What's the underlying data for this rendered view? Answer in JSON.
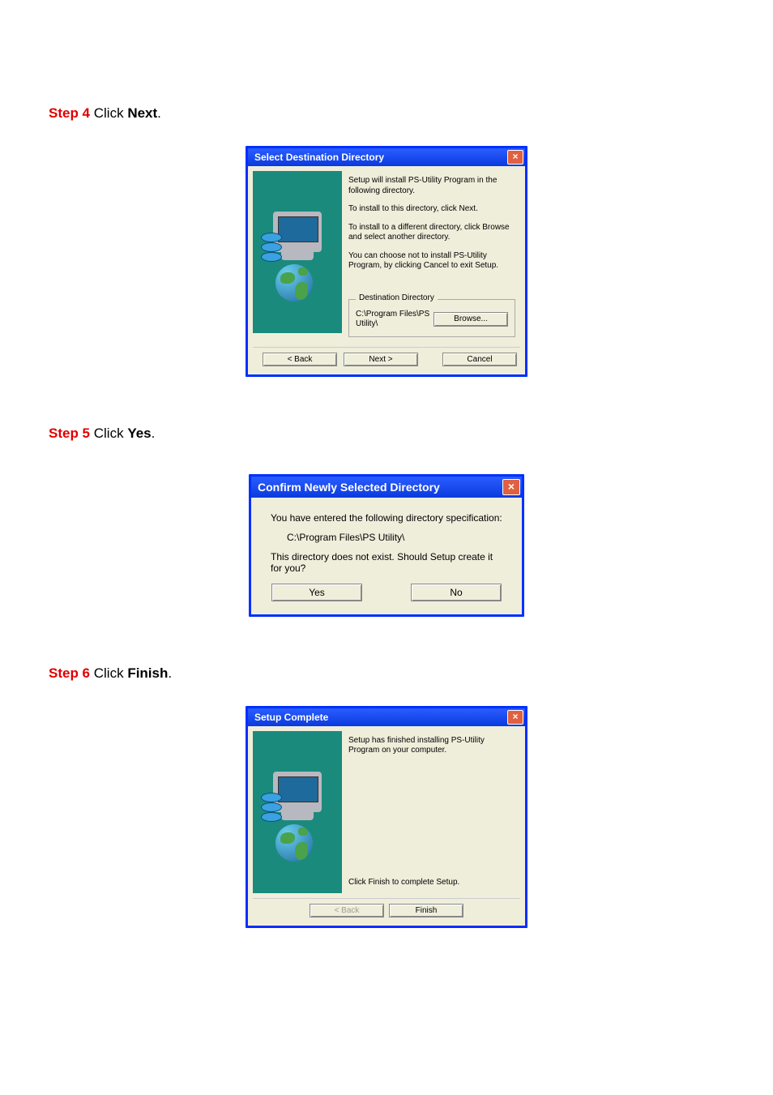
{
  "steps": {
    "s4": {
      "prefix": "Step 4 ",
      "text_before": "Click ",
      "bold": "Next",
      "after": "."
    },
    "s5": {
      "prefix": "Step 5 ",
      "text_before": "Click ",
      "bold": "Yes",
      "after": "."
    },
    "s6": {
      "prefix": "Step 6 ",
      "text_before": "Click ",
      "bold": "Finish",
      "after": "."
    }
  },
  "dialog1": {
    "title": "Select Destination Directory",
    "p1": "Setup will install PS-Utility Program in the following directory.",
    "p2": "To install to this directory, click Next.",
    "p3": "To install to a different directory, click Browse and select another directory.",
    "p4": "You can choose not to install PS-Utility Program, by clicking Cancel to exit Setup.",
    "dest_label": "Destination Directory",
    "dest_path": "C:\\Program Files\\PS Utility\\",
    "browse": "Browse...",
    "back": "< Back",
    "next": "Next >",
    "cancel": "Cancel"
  },
  "dialog2": {
    "title": "Confirm Newly Selected Directory",
    "line1": "You have entered the following directory specification:",
    "path": "C:\\Program Files\\PS Utility\\",
    "line2": "This directory does not exist.  Should Setup create it for you?",
    "yes": "Yes",
    "no": "No"
  },
  "dialog3": {
    "title": "Setup Complete",
    "p1": "Setup has finished installing PS-Utility Program on your computer.",
    "p2": "Click Finish to complete Setup.",
    "back": "< Back",
    "finish": "Finish"
  }
}
